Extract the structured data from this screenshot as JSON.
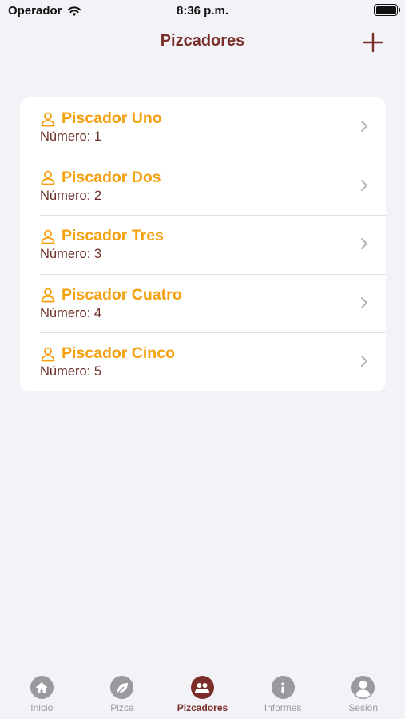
{
  "status_bar": {
    "carrier": "Operador",
    "time": "8:36 p.m."
  },
  "nav": {
    "title": "Pizcadores",
    "add_icon": "plus-icon"
  },
  "pickers": [
    {
      "name": "Piscador Uno",
      "number": "Número: 1"
    },
    {
      "name": "Piscador Dos",
      "number": "Número: 2"
    },
    {
      "name": "Piscador Tres",
      "number": "Número: 3"
    },
    {
      "name": "Piscador Cuatro",
      "number": "Número: 4"
    },
    {
      "name": "Piscador Cinco",
      "number": "Número: 5"
    }
  ],
  "tabs": [
    {
      "label": "Inicio",
      "icon": "house-icon"
    },
    {
      "label": "Pizca",
      "icon": "leaf-icon"
    },
    {
      "label": "Pizcadores",
      "icon": "people-icon",
      "active": true
    },
    {
      "label": "Informes",
      "icon": "info-icon"
    },
    {
      "label": "Sesión",
      "icon": "person-icon"
    }
  ],
  "colors": {
    "accent": "#7a2e2a",
    "row_title": "#f5a00e",
    "background": "#f2f2f7",
    "tab_inactive": "#9a9a9e"
  }
}
